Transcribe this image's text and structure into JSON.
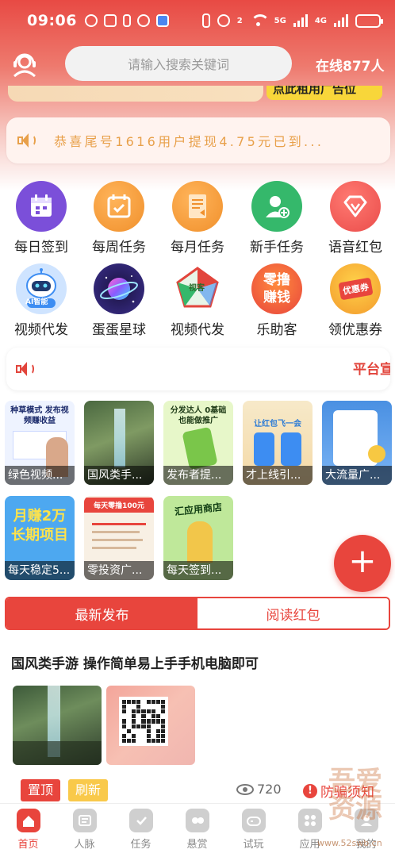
{
  "status": {
    "time": "09:06",
    "network_tag_1": "5G",
    "network_tag_2": "4G",
    "wifi_tag": "2",
    "battery_level": 0.62
  },
  "header": {
    "search_placeholder": "请输入搜索关键词",
    "online_text": "在线877人"
  },
  "banner": {
    "peek_text": "点此租用广告位"
  },
  "notice": {
    "text": "恭喜尾号1616用户提现4.75元已到..."
  },
  "grid_items": [
    {
      "label": "每日签到",
      "icon": "calendar-icon",
      "color": "#7b4fd9"
    },
    {
      "label": "每周任务",
      "icon": "calendar-check-icon",
      "color": "#f0902c"
    },
    {
      "label": "每月任务",
      "icon": "document-icon",
      "color": "#f0902c"
    },
    {
      "label": "新手任务",
      "icon": "user-add-icon",
      "color": "#35b86b"
    },
    {
      "label": "语音红包",
      "icon": "gem-icon",
      "color": "#ea4c4a"
    },
    {
      "label": "视频代发",
      "icon": "robot-icon",
      "color": "#3d8df2",
      "badge": "AI智能"
    },
    {
      "label": "蛋蛋星球",
      "icon": "planet-icon",
      "color": "#3b2f8c"
    },
    {
      "label": "视频代发",
      "icon": "pentagon-icon",
      "color": "#e2453c",
      "badge": "视客"
    },
    {
      "label": "乐助客",
      "icon": "zero-icon",
      "color": "#e8453d",
      "badge": "零撸赚钱"
    },
    {
      "label": "领优惠券",
      "icon": "coupon-icon",
      "color": "#e8453d",
      "badge": "优惠券"
    }
  ],
  "platform_notice": {
    "text": "平台宣"
  },
  "tiles": [
    {
      "caption": "绿色视频...",
      "art": "种草模式 发布视频赚收益"
    },
    {
      "caption": "国风类手...",
      "art": ""
    },
    {
      "caption": "发布者提...",
      "art": "分发达人 0基础也能做推广"
    },
    {
      "caption": "才上线引...",
      "art": "让红包飞一会"
    },
    {
      "caption": "大流量广...",
      "art": ""
    },
    {
      "caption": "每天稳定5...",
      "art": "月赚2万 长期项目"
    },
    {
      "caption": "零投资广...",
      "art": "每天零撸100元"
    },
    {
      "caption": "每天签到...",
      "art": "汇应用商店"
    }
  ],
  "tabs": {
    "latest": "最新发布",
    "read_red_packet": "阅读红包"
  },
  "post": {
    "title": "国风类手游 操作简单易上手手机电脑即可",
    "top_label": "置顶",
    "refresh_label": "刷新",
    "views": "720",
    "fraud_label": "防骗须知"
  },
  "nav": [
    {
      "label": "首页",
      "icon": "home-icon",
      "active": true
    },
    {
      "label": "人脉",
      "icon": "contacts-icon",
      "active": false
    },
    {
      "label": "任务",
      "icon": "task-icon",
      "active": false
    },
    {
      "label": "悬赏",
      "icon": "reward-icon",
      "active": false
    },
    {
      "label": "试玩",
      "icon": "gamepad-icon",
      "active": false
    },
    {
      "label": "应用",
      "icon": "apps-icon",
      "active": false
    },
    {
      "label": "我的",
      "icon": "user-icon",
      "active": false
    }
  ],
  "watermark": {
    "text": "吾爱资源",
    "url": "www.52swb.cn"
  },
  "colors": {
    "accent": "#e8453d",
    "notice_text": "#e8a04a",
    "refresh": "#f9c94a"
  }
}
